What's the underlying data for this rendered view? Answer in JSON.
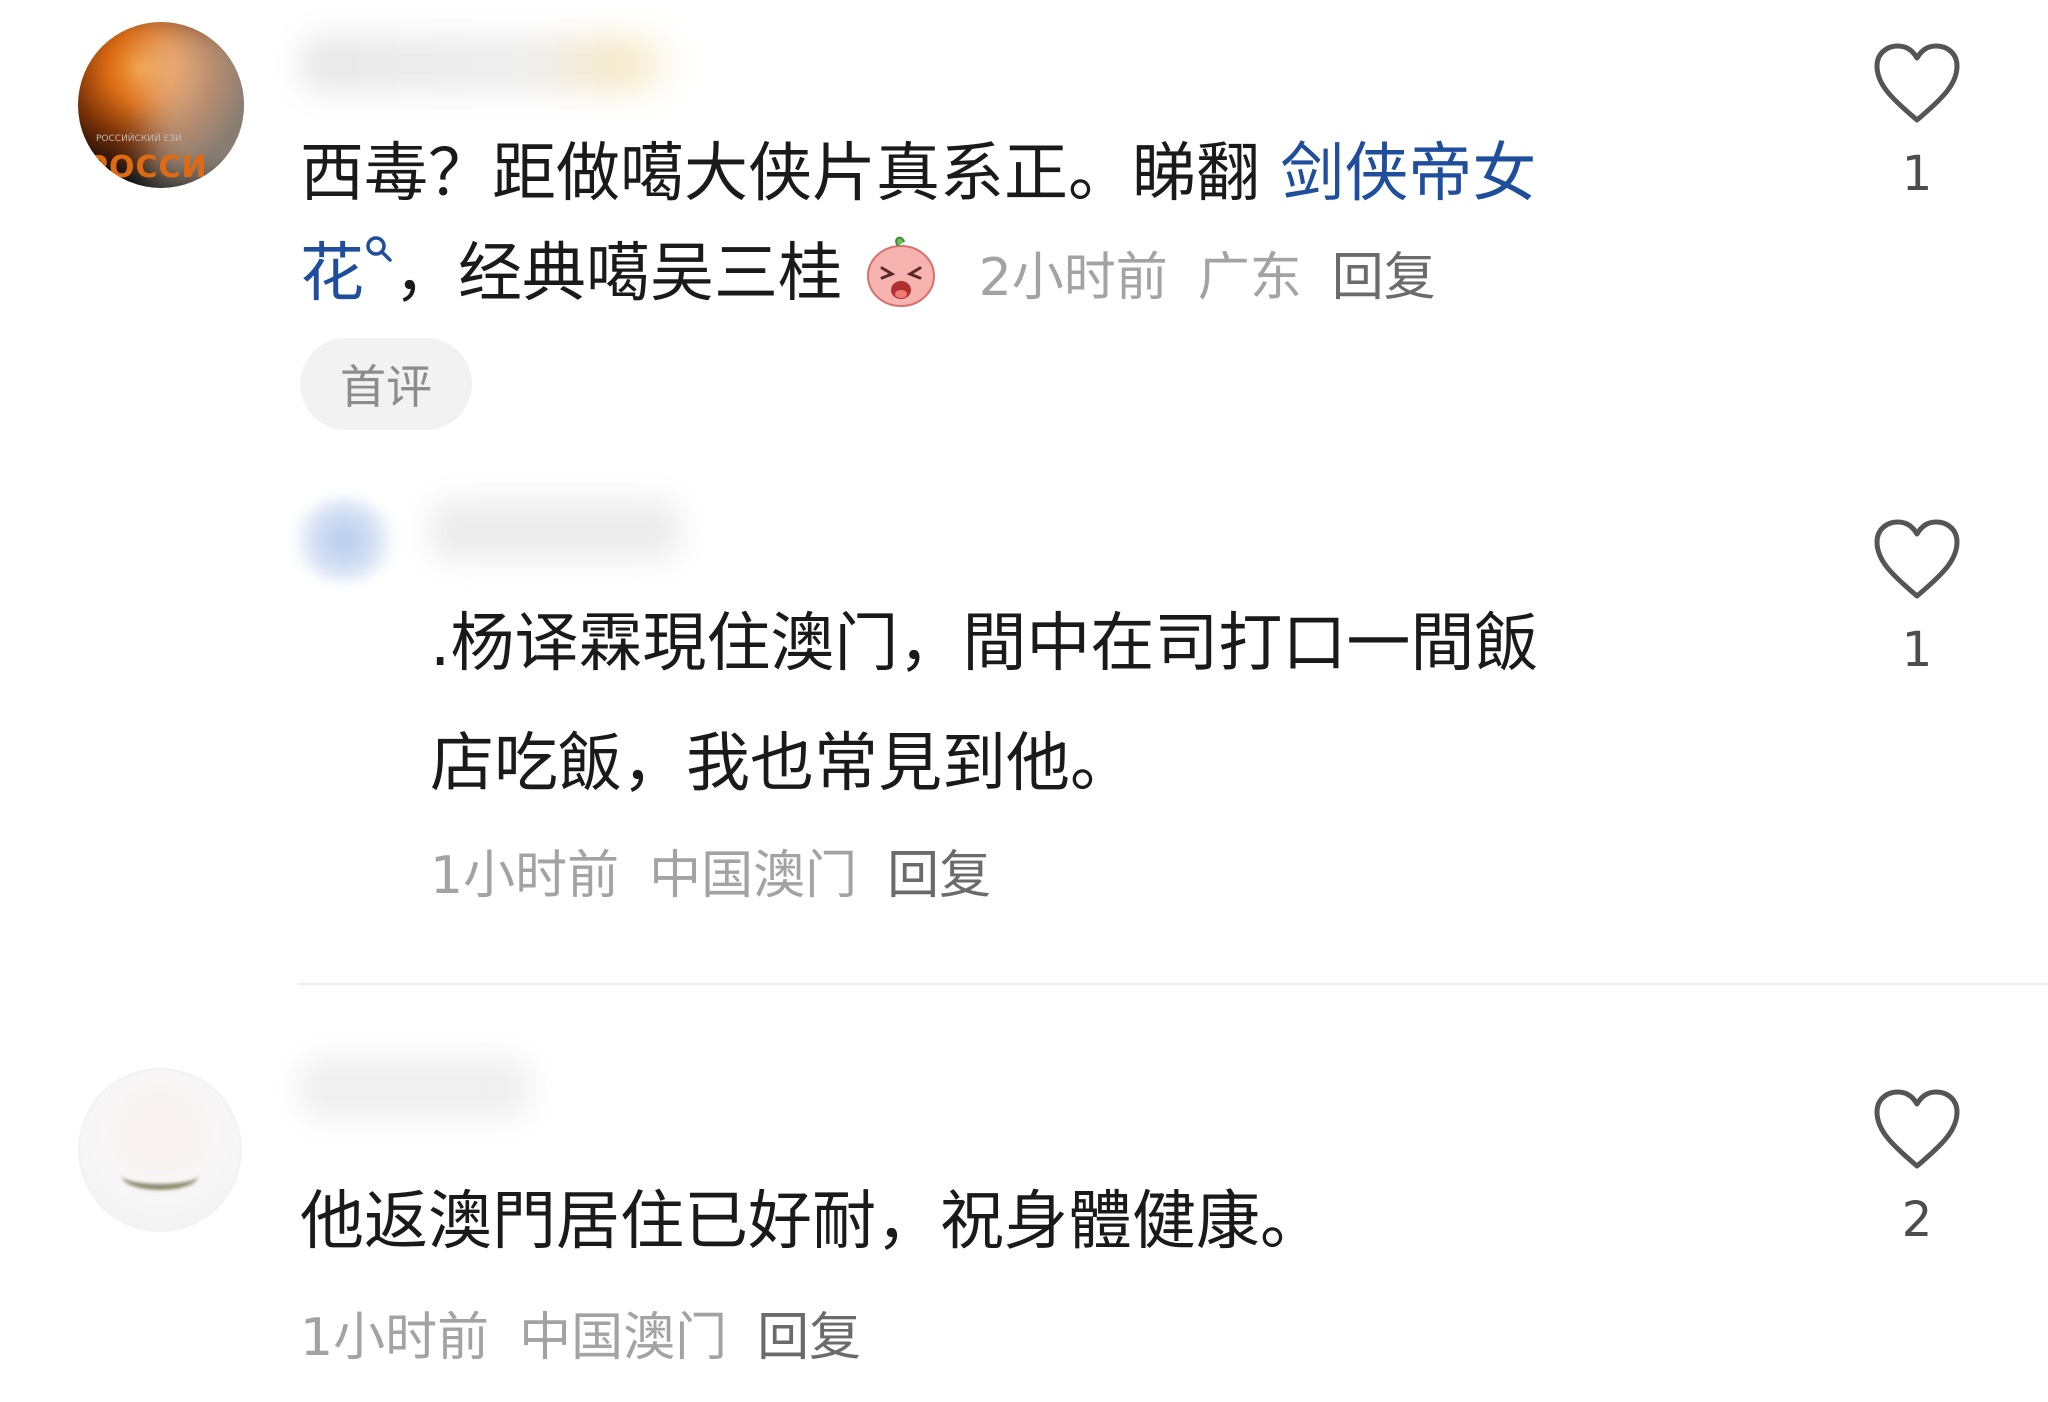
{
  "comments": [
    {
      "avatar_logo": "POCCИ",
      "avatar_logo_sub": "РОССИЙСКИЙ ЕЗИ",
      "text_line1_plain": "西毒？距做噶大侠片真系正。睇翻 ",
      "text_line1_link": "剑侠帝女",
      "text_line2_link": "花",
      "text_line2_plain": "，经典噶吴三桂",
      "emoji": "crying-peach-emoji",
      "time": "2小时前",
      "location": "广东",
      "reply": "回复",
      "badge": "首评",
      "likes": "1"
    },
    {
      "text_line1": ".杨译霖現住澳门，間中在司打口一間飯",
      "text_line2": "店吃飯，我也常見到他。",
      "time": "1小时前",
      "location": "中国澳门",
      "reply": "回复",
      "likes": "1"
    },
    {
      "text_line1": "他返澳門居住已好耐，祝身體健康。",
      "time": "1小时前",
      "location": "中国澳门",
      "reply": "回复",
      "likes": "2"
    }
  ],
  "icons": {
    "search": "search-icon",
    "like": "heart-outline-icon"
  },
  "colors": {
    "link": "#1f4e9c",
    "meta": "#a3a3a3",
    "badge_bg": "#f2f2f2"
  }
}
